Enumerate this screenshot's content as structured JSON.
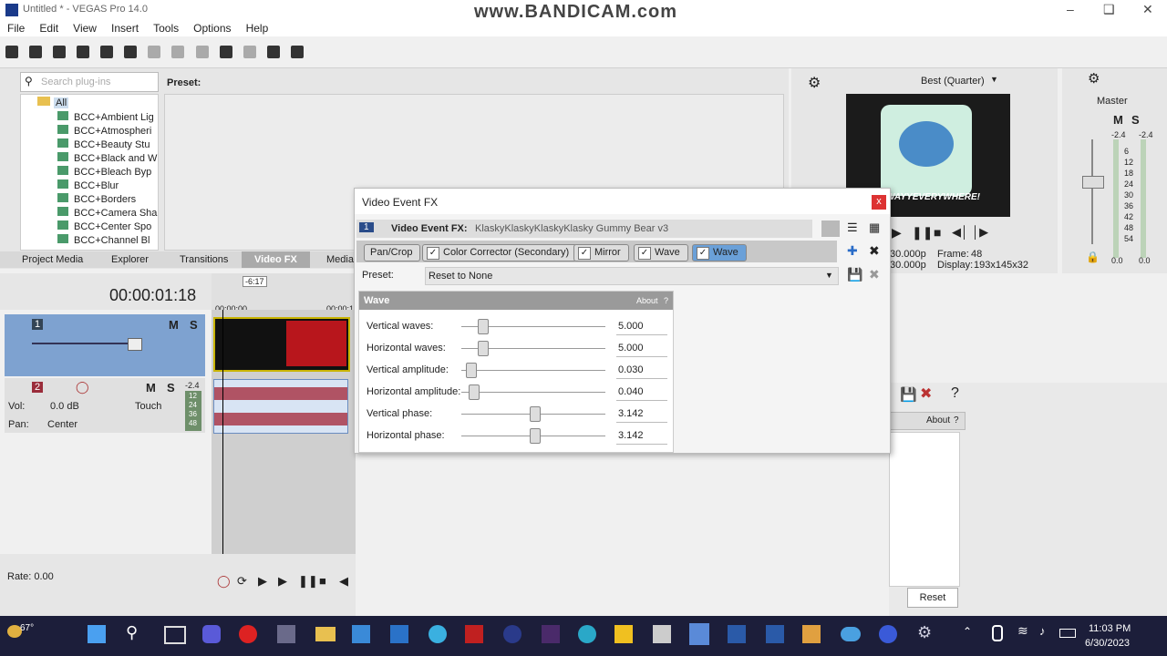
{
  "window": {
    "title": "Untitled * - VEGAS Pro 14.0",
    "watermark": "www.BANDICAM.com"
  },
  "menu": [
    "File",
    "Edit",
    "View",
    "Insert",
    "Tools",
    "Options",
    "Help"
  ],
  "plugins": {
    "search_placeholder": "Search plug-ins",
    "root": "All",
    "items": [
      "BCC+Ambient Lig",
      "BCC+Atmospheri",
      "BCC+Beauty Stu",
      "BCC+Black and W",
      "BCC+Bleach Byp",
      "BCC+Blur",
      "BCC+Borders",
      "BCC+Camera Sha",
      "BCC+Center Spo",
      "BCC+Channel Bl"
    ],
    "preset_label": "Preset:"
  },
  "panel_tabs": [
    "Project Media",
    "Explorer",
    "Transitions",
    "Video FX",
    "Media"
  ],
  "timeline": {
    "timecode": "00:00:01:18",
    "ruler_start": "00:00:00",
    "ruler_next": "00:00:1",
    "marker": "-6:17",
    "track1_num": "1",
    "track2_num": "2",
    "vol_label": "Vol:",
    "vol_value": "0.0 dB",
    "pan_label": "Pan:",
    "pan_value": "Center",
    "touch_label": "Touch",
    "meter_top": "-2.4",
    "meter_vals": [
      "12",
      "24",
      "36",
      "48"
    ],
    "rate": "Rate: 0.00",
    "m_label": "M",
    "s_label": "S"
  },
  "preview": {
    "quality": "Best (Quarter)",
    "frame_label": "Frame:",
    "frame_value": "48",
    "display_label": "Display:",
    "display_value": "193x145x32",
    "fps1": "30.000p",
    "fps2": "30.000p",
    "video_text": "WAYYEVERYWHERE!"
  },
  "master": {
    "label": "Master",
    "m_label": "M",
    "s_label": "S",
    "top_left": "-2.4",
    "top_right": "-2.4",
    "scale": [
      "6",
      "12",
      "18",
      "24",
      "30",
      "36",
      "42",
      "48",
      "54"
    ],
    "bottom_left": "0.0",
    "bottom_right": "0.0"
  },
  "dialog": {
    "title": "Video Event FX",
    "close_label": "x",
    "header_label": "Video Event FX:",
    "header_num": "1",
    "header_value": "KlaskyKlaskyKlaskyKlasky Gummy Bear v3",
    "chain": [
      "Pan/Crop",
      "Color Corrector (Secondary)",
      "Mirror",
      "Wave",
      "Wave"
    ],
    "preset_label": "Preset:",
    "preset_value": "Reset to None",
    "wave_title": "Wave",
    "about": "About",
    "help": "?",
    "params": [
      {
        "label": "Vertical waves:",
        "value": "5.000",
        "level": 0.12
      },
      {
        "label": "Horizontal waves:",
        "value": "5.000",
        "level": 0.12
      },
      {
        "label": "Vertical amplitude:",
        "value": "0.030",
        "level": 0.03
      },
      {
        "label": "Horizontal amplitude:",
        "value": "0.040",
        "level": 0.05
      },
      {
        "label": "Vertical phase:",
        "value": "3.142",
        "level": 0.5
      },
      {
        "label": "Horizontal phase:",
        "value": "3.142",
        "level": 0.5
      }
    ]
  },
  "right_panel": {
    "about": "About",
    "help": "?",
    "reset": "Reset",
    "question": "?"
  },
  "taskbar": {
    "temp": "67°",
    "time": "11:03 PM",
    "date": "6/30/2023"
  },
  "colors": {
    "accent": "#6aa0d8",
    "track_video": "#7ea2d0",
    "track_audio": "#9a2c3a",
    "taskbar": "#1c1e3a"
  }
}
